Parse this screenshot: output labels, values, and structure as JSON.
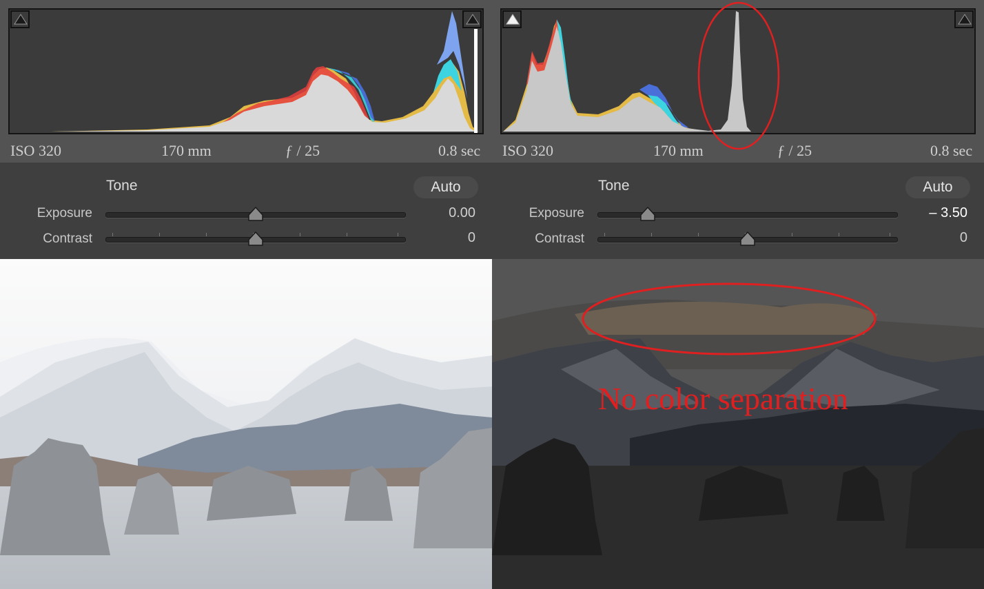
{
  "panels": [
    {
      "iso": "ISO 320",
      "focal": "170 mm",
      "aperture": "ƒ / 25",
      "shutter": "0.8 sec",
      "tone_label": "Tone",
      "auto_label": "Auto",
      "exposure_label": "Exposure",
      "exposure_value": "0.00",
      "contrast_label": "Contrast",
      "contrast_value": "0",
      "shadow_clip_warning": false
    },
    {
      "iso": "ISO 320",
      "focal": "170 mm",
      "aperture": "ƒ / 25",
      "shutter": "0.8 sec",
      "tone_label": "Tone",
      "auto_label": "Auto",
      "exposure_label": "Exposure",
      "exposure_value": "– 3.50",
      "contrast_label": "Contrast",
      "contrast_value": "0",
      "shadow_clip_warning": true
    }
  ],
  "sliders": {
    "exposure_range": [
      -5,
      5
    ],
    "contrast_range": [
      -100,
      100
    ],
    "left_exposure": 0,
    "right_exposure": -3.5,
    "contrast": 0
  },
  "annotation": {
    "text": "No color separation",
    "color": "#e02020"
  },
  "colors": {
    "panel_bg": "#535353",
    "tone_bg": "#3f3f3f",
    "histogram_bg": "#3b3b3b",
    "annotation_red": "#e02020"
  }
}
